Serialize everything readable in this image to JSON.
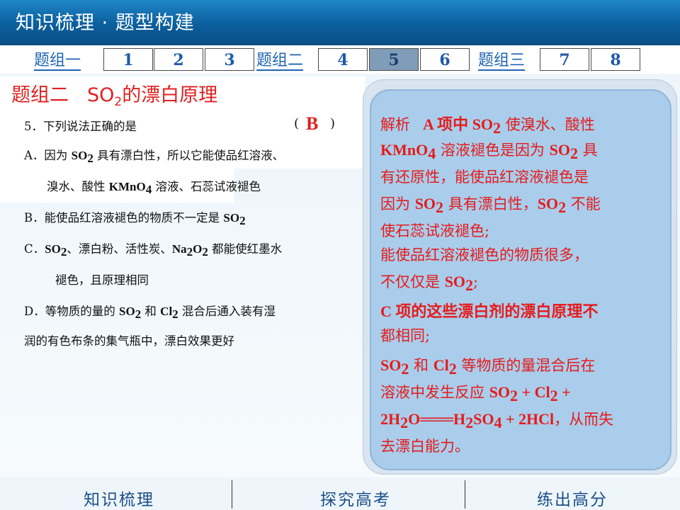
{
  "header": {
    "title": "知识梳理 · 题型构建"
  },
  "nav": {
    "group1": "题组一",
    "group2": "题组二",
    "group3": "题组三",
    "b1": "1",
    "b2": "2",
    "b3": "3",
    "b4": "4",
    "b5": "5",
    "b6": "6",
    "b7": "7",
    "b8": "8"
  },
  "section": {
    "prefix": "题组二",
    "so": "SO",
    "two": "2",
    "suffix": "的漂白原理"
  },
  "question": {
    "stem_num": "5．",
    "stem": "下列说法正确的是",
    "paren_open": "(",
    "answer": "B",
    "paren_close": ")",
    "a_label": "A．",
    "a1_pre": "因为 ",
    "a1_post": " 具有漂白性，所以它能使品红溶液、",
    "a2_pre": "溴水、酸性 ",
    "a2_post": " 溶液、石蕊试液褪色",
    "b_label": "B．",
    "b_pre": "能使品红溶液褪色的物质不一定是 ",
    "c_label": "C．",
    "c_mid1": "、漂白粉、活性炭、",
    "c_mid2": " 都能使红墨水",
    "c2": "褪色，且原理相同",
    "d_label": "D．",
    "d_pre": "等物质的量的 ",
    "d_mid": " 和 ",
    "d_post": " 混合后通入装有湿",
    "d2": "润的有色布条的集气瓶中，漂白效果更好"
  },
  "chem": {
    "SO": "SO",
    "sub2": "2",
    "KMnO": "KMnO",
    "sub4": "4",
    "Na": "Na",
    "O": "O",
    "Cl": "Cl",
    "H": "H",
    "HCl": "HCl"
  },
  "analysis": {
    "l1_label": "解析",
    "l1_a": "A 项中 ",
    "l1_b": " 使溴水、酸性",
    "l2_b": " 溶液褪色是因为 ",
    "l2_c": " 具",
    "l3": "有还原性，能使品红溶液褪色是",
    "l4_a": "因为 ",
    "l4_b": " 具有漂白性，",
    "l4_c": " 不能",
    "l5": "使石蕊试液褪色;",
    "l6": "能使品红溶液褪色的物质很多，",
    "l7_a": "不仅仅是 ",
    "l7_b": ";",
    "l8": "C 项的这些漂白剂的漂白原理不",
    "l9": "都相同;",
    "l10_mid": " 和 ",
    "l10_post": " 等物质的量混合后在",
    "l11_a": "溶液中发生反应 ",
    "l11_plus": " + ",
    "l12_eq": "O═══",
    "l12_plus": " + 2",
    "l12_post": "，从而失",
    "l13": "去漂白能力。",
    "two_prefix": "2"
  },
  "footer": {
    "left": "知识梳理",
    "mid": "探究高考",
    "right": "练出高分"
  }
}
